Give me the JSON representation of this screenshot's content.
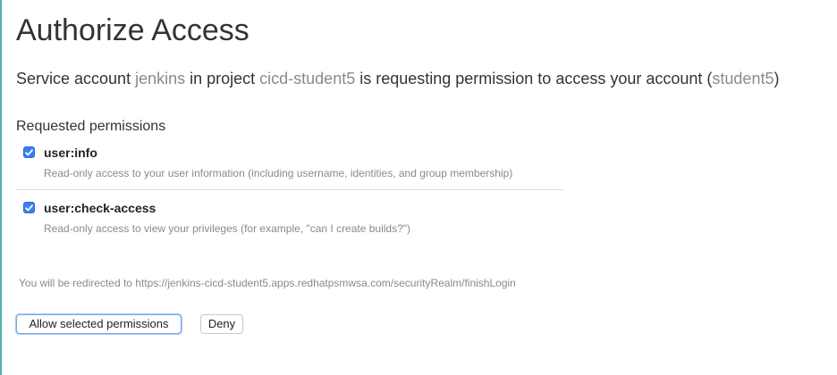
{
  "page": {
    "title": "Authorize Access"
  },
  "request": {
    "prefix": "Service account ",
    "service_account": "jenkins",
    "middle": " in project ",
    "project": "cicd-student5",
    "suffix": " is requesting permission to access your account (",
    "account": "student5",
    "close": ")"
  },
  "permissions": {
    "header": "Requested permissions",
    "items": [
      {
        "name": "user:info",
        "description": "Read-only access to your user information (including username, identities, and group membership)",
        "checked": true
      },
      {
        "name": "user:check-access",
        "description": "Read-only access to view your privileges (for example, \"can I create builds?\")",
        "checked": true
      }
    ]
  },
  "redirect": {
    "text": "You will be redirected to https://jenkins-cicd-student5.apps.redhatpsmwsa.com/securityRealm/finishLogin"
  },
  "actions": {
    "allow_label": "Allow selected permissions",
    "deny_label": "Deny"
  },
  "colors": {
    "accent_border": "#4fb3b1",
    "checkbox": "#3b7ef0",
    "muted_text": "#8a8a8a"
  }
}
